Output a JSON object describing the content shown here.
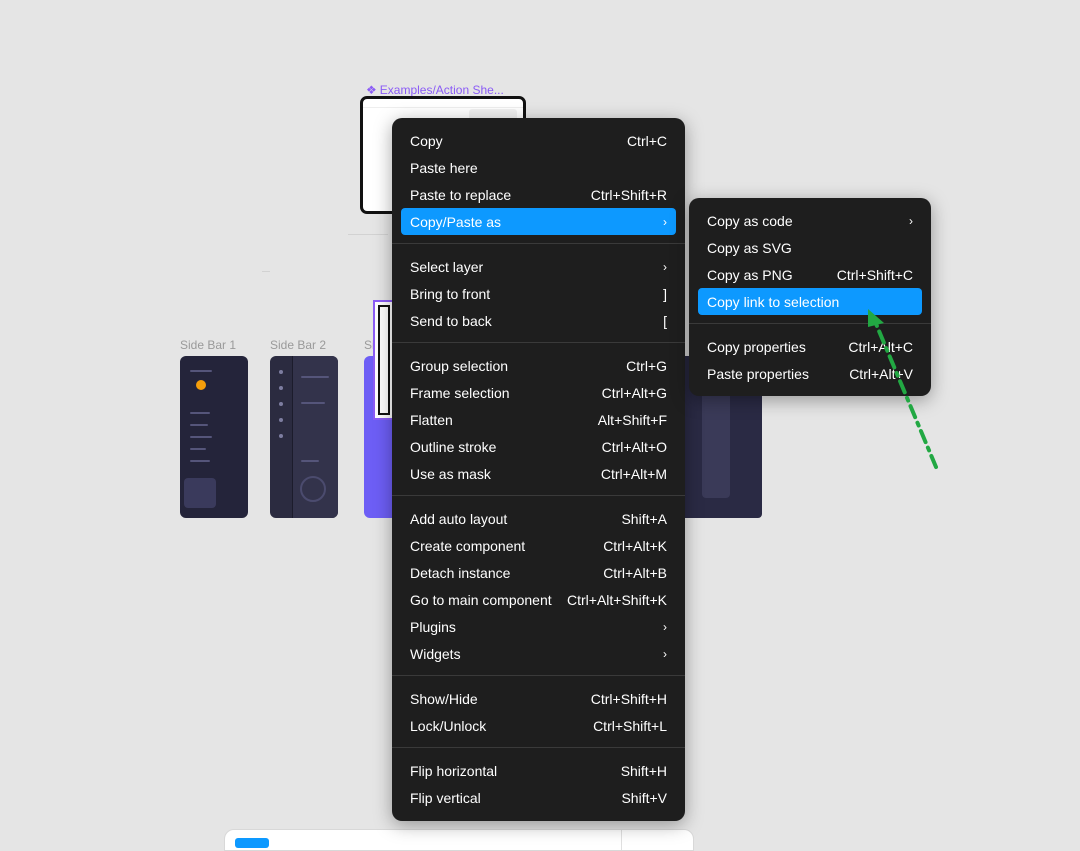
{
  "canvas": {
    "component_label": "Examples/Action She...",
    "frame_labels": [
      "Side Bar 1",
      "Side Bar 2",
      "Side"
    ]
  },
  "main_menu": {
    "groups": [
      [
        {
          "label": "Copy",
          "shortcut": "Ctrl+C"
        },
        {
          "label": "Paste here",
          "shortcut": ""
        },
        {
          "label": "Paste to replace",
          "shortcut": "Ctrl+Shift+R"
        },
        {
          "label": "Copy/Paste as",
          "shortcut": "›",
          "active": true
        }
      ],
      [
        {
          "label": "Select layer",
          "shortcut": "›"
        },
        {
          "label": "Bring to front",
          "shortcut": "]"
        },
        {
          "label": "Send to back",
          "shortcut": "["
        }
      ],
      [
        {
          "label": "Group selection",
          "shortcut": "Ctrl+G"
        },
        {
          "label": "Frame selection",
          "shortcut": "Ctrl+Alt+G"
        },
        {
          "label": "Flatten",
          "shortcut": "Alt+Shift+F"
        },
        {
          "label": "Outline stroke",
          "shortcut": "Ctrl+Alt+O"
        },
        {
          "label": "Use as mask",
          "shortcut": "Ctrl+Alt+M"
        }
      ],
      [
        {
          "label": "Add auto layout",
          "shortcut": "Shift+A"
        },
        {
          "label": "Create component",
          "shortcut": "Ctrl+Alt+K"
        },
        {
          "label": "Detach instance",
          "shortcut": "Ctrl+Alt+B"
        },
        {
          "label": "Go to main component",
          "shortcut": "Ctrl+Alt+Shift+K"
        },
        {
          "label": "Plugins",
          "shortcut": "›"
        },
        {
          "label": "Widgets",
          "shortcut": "›"
        }
      ],
      [
        {
          "label": "Show/Hide",
          "shortcut": "Ctrl+Shift+H"
        },
        {
          "label": "Lock/Unlock",
          "shortcut": "Ctrl+Shift+L"
        }
      ],
      [
        {
          "label": "Flip horizontal",
          "shortcut": "Shift+H"
        },
        {
          "label": "Flip vertical",
          "shortcut": "Shift+V"
        }
      ]
    ]
  },
  "sub_menu": {
    "groups": [
      [
        {
          "label": "Copy as code",
          "shortcut": "›"
        },
        {
          "label": "Copy as SVG",
          "shortcut": ""
        },
        {
          "label": "Copy as PNG",
          "shortcut": "Ctrl+Shift+C"
        },
        {
          "label": "Copy link to selection",
          "shortcut": "",
          "active": true
        }
      ],
      [
        {
          "label": "Copy properties",
          "shortcut": "Ctrl+Alt+C"
        },
        {
          "label": "Paste properties",
          "shortcut": "Ctrl+Alt+V"
        }
      ]
    ]
  },
  "colors": {
    "menu_bg": "#1e1e1e",
    "highlight": "#0d99ff",
    "canvas_bg": "#e5e5e5",
    "component_purple": "#8b5cf6",
    "annotation_arrow": "#22a843"
  }
}
